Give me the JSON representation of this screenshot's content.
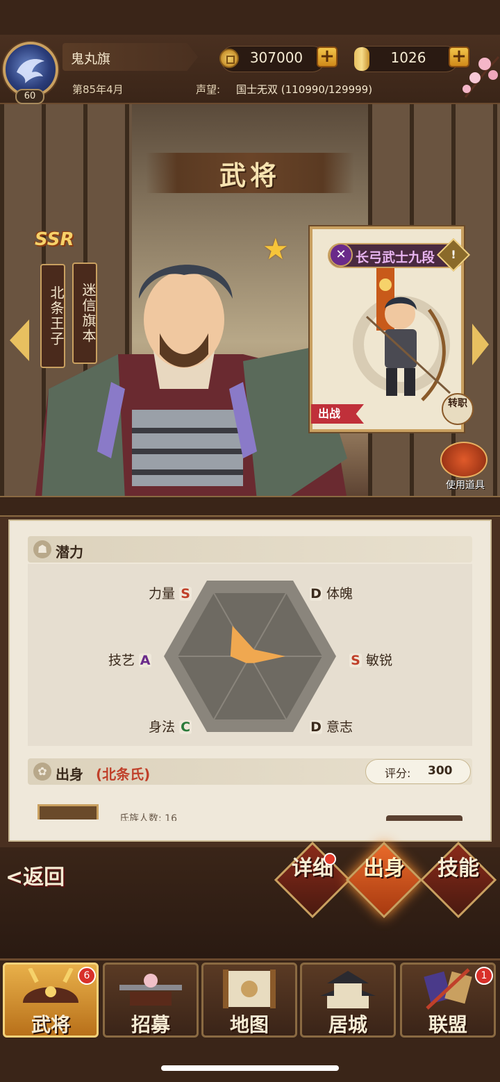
{
  "header": {
    "player_name": "鬼丸旗",
    "level": "60",
    "date": "第85年4月",
    "coins": "307000",
    "rice": "1026",
    "reputation_label": "声望:",
    "reputation_value": "国士无双 (110990/129999)"
  },
  "page_title": "武将",
  "general": {
    "rarity": "SSR",
    "name": "北条王子",
    "title": "迷信旗本",
    "class_name": "长弓武士九段",
    "deploy_label": "出战",
    "job_change_label": "转职",
    "use_item_label": "使用道具"
  },
  "potential": {
    "section_title": "潜力",
    "stats": [
      {
        "name": "力量",
        "grade": "S",
        "grade_color": "#c0402a",
        "value": 0.45
      },
      {
        "name": "体魄",
        "grade": "D",
        "grade_color": "#3a2a1c",
        "value": 0.1
      },
      {
        "name": "敏锐",
        "grade": "S",
        "grade_color": "#c0402a",
        "value": 0.45
      },
      {
        "name": "意志",
        "grade": "D",
        "grade_color": "#3a2a1c",
        "value": 0.1
      },
      {
        "name": "身法",
        "grade": "C",
        "grade_color": "#2a7a3a",
        "value": 0.1
      },
      {
        "name": "技艺",
        "grade": "A",
        "grade_color": "#6a2a8a",
        "value": 0.25
      }
    ]
  },
  "origin": {
    "section_title": "出身",
    "family": "(北条氏)",
    "score_label": "评分:",
    "score_value": "300",
    "peek_text": "氏族人数: 16"
  },
  "actions": {
    "back": "<返回",
    "detail": "详细",
    "origin": "出身",
    "skill": "技能"
  },
  "nav": {
    "general": "武将",
    "general_badge": "6",
    "recruit": "招募",
    "map": "地图",
    "castle": "居城",
    "alliance": "联盟",
    "alliance_badge": "1"
  },
  "colors": {
    "accent_gold": "#c9a060",
    "radar_fill": "#f0a850",
    "active_tab": "#e8b04a"
  }
}
